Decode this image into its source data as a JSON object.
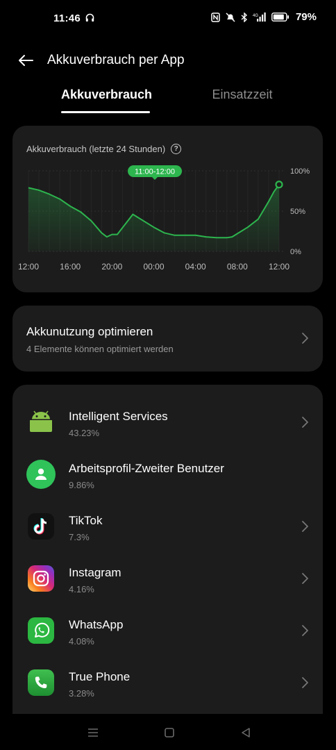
{
  "status_bar": {
    "time": "11:46",
    "battery": "79%",
    "network": "4G"
  },
  "header": {
    "title": "Akkuverbrauch per App"
  },
  "tabs": [
    {
      "label": "Akkuverbrauch",
      "active": true
    },
    {
      "label": "Einsatzzeit",
      "active": false
    }
  ],
  "chart_card": {
    "title": "Akkuverbrauch (letzte 24 Stunden)",
    "tooltip": "11:00-12:00"
  },
  "chart_data": {
    "type": "area",
    "title": "Akkuverbrauch (letzte 24 Stunden)",
    "x_tick_labels": [
      "12:00",
      "16:00",
      "20:00",
      "00:00",
      "04:00",
      "08:00",
      "12:00"
    ],
    "y_tick_labels": [
      "100%",
      "50%",
      "0%"
    ],
    "ylim": [
      0,
      100
    ],
    "x_range": [
      0,
      24
    ],
    "series": [
      {
        "x": [
          0,
          1,
          2,
          3,
          4,
          5,
          6,
          7,
          7.5,
          8,
          8.5,
          10,
          12,
          13,
          14,
          15,
          16,
          17,
          18,
          19,
          19.5,
          20,
          21,
          22,
          23,
          23.5,
          24
        ],
        "y": [
          79,
          76,
          71,
          65,
          56,
          49,
          38,
          23,
          18,
          21,
          21,
          46,
          30,
          23,
          20,
          20,
          20,
          18,
          17,
          17,
          18,
          22,
          30,
          40,
          62,
          74,
          83
        ],
        "values_note_hidden": false
      }
    ],
    "color": "#2db54e",
    "highlight": {
      "x": 23.5,
      "label": "11:00-12:00"
    },
    "grid": true
  },
  "optimize": {
    "title": "Akkunutzung optimieren",
    "subtitle": "4 Elemente können optimiert werden"
  },
  "apps": [
    {
      "name": "Intelligent Services",
      "percent": "43.23%",
      "icon": "android-icon",
      "chevron": true
    },
    {
      "name": "Arbeitsprofil-Zweiter Benutzer",
      "percent": "9.86%",
      "icon": "work-profile-icon",
      "chevron": false
    },
    {
      "name": "TikTok",
      "percent": "7.3%",
      "icon": "tiktok-icon",
      "chevron": true
    },
    {
      "name": "Instagram",
      "percent": "4.16%",
      "icon": "instagram-icon",
      "chevron": true
    },
    {
      "name": "WhatsApp",
      "percent": "4.08%",
      "icon": "whatsapp-icon",
      "chevron": true
    },
    {
      "name": "True Phone",
      "percent": "3.28%",
      "icon": "phone-icon",
      "chevron": true
    }
  ],
  "colors": {
    "accent": "#2db54e",
    "card": "#1c1c1c",
    "background": "#000000"
  }
}
